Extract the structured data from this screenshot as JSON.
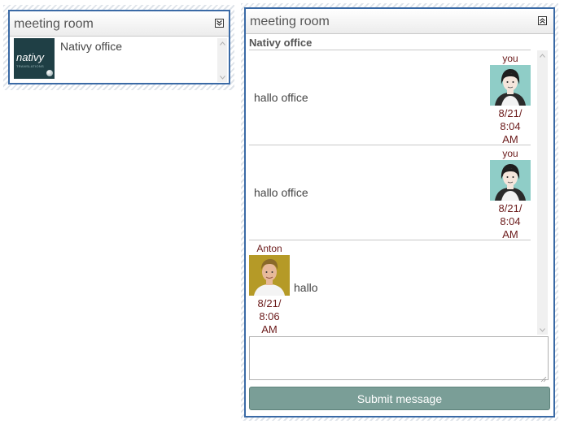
{
  "left_panel": {
    "title": "meeting room",
    "toggle_icon": "chevron-double-down-icon",
    "room": {
      "name": "Nativy office",
      "logo_text": "nativy",
      "logo_subtext": "TRANSLATIONS",
      "logo_color": "#1f3f45"
    }
  },
  "right_panel": {
    "title": "meeting room",
    "toggle_icon": "chevron-double-up-icon",
    "room_name": "Nativy office",
    "messages": [
      {
        "sender": "you",
        "text": "hallo office",
        "time_lines": [
          "8/21/",
          "8:04",
          "AM"
        ],
        "avatar": "female-avatar-icon"
      },
      {
        "sender": "you",
        "text": "hallo office",
        "time_lines": [
          "8/21/",
          "8:04",
          "AM"
        ],
        "avatar": "female-avatar-icon"
      },
      {
        "sender": "Anton",
        "text": "hallo",
        "time_lines": [
          "8/21/",
          "8:06",
          "AM"
        ],
        "avatar": "male-photo-avatar"
      }
    ],
    "input": {
      "value": "",
      "placeholder": ""
    },
    "submit_label": "Submit message"
  },
  "colors": {
    "panel_border": "#3a6aa6",
    "accent_text": "#6b1a1a",
    "submit_bg": "#7a9e97",
    "avatar_bg": "#8fcdc7"
  }
}
